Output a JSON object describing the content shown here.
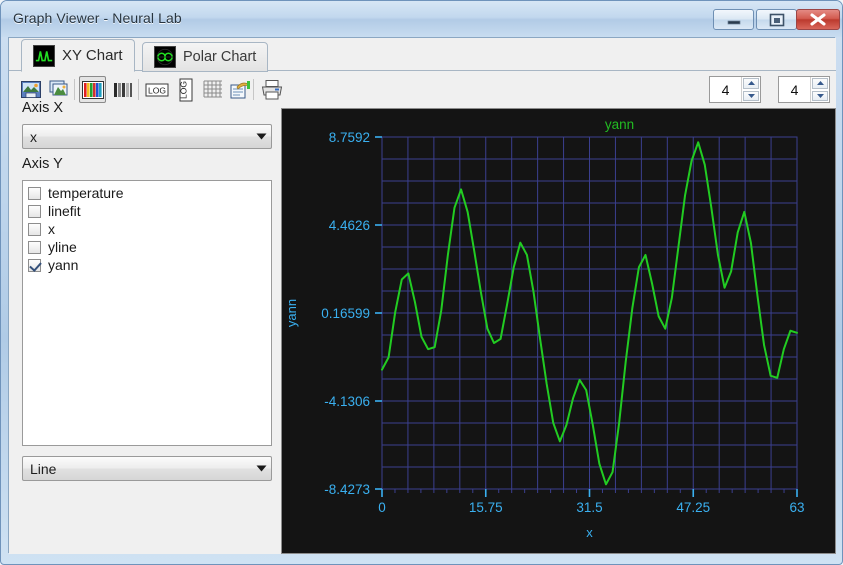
{
  "window": {
    "title": "Graph Viewer - Neural Lab",
    "buttons": [
      {
        "name": "minimize",
        "glyph": "minimize-icon"
      },
      {
        "name": "maximize",
        "glyph": "restore-icon"
      },
      {
        "name": "close",
        "glyph": "close-icon"
      }
    ]
  },
  "tabs": [
    {
      "label": "XY Chart",
      "icon": "waveform-icon",
      "active": true
    },
    {
      "label": "Polar Chart",
      "icon": "polar-grid-icon",
      "active": false
    }
  ],
  "toolbar": {
    "buttons": [
      {
        "name": "save-image-button",
        "icon": "save-image-icon",
        "pressed": false
      },
      {
        "name": "copy-image-button",
        "icon": "copy-image-icon",
        "pressed": false
      },
      {
        "name": "color-series-button",
        "icon": "color-bars-icon",
        "pressed": true
      },
      {
        "name": "grayscale-series-button",
        "icon": "gray-bars-icon",
        "pressed": false
      },
      {
        "name": "log-x-button",
        "icon": "log-x-icon",
        "pressed": false
      },
      {
        "name": "log-y-button",
        "icon": "log-y-icon",
        "pressed": false
      },
      {
        "name": "grid-button",
        "icon": "grid-icon",
        "pressed": false
      },
      {
        "name": "legend-button",
        "icon": "legend-icon",
        "pressed": false
      },
      {
        "name": "print-button",
        "icon": "printer-icon",
        "pressed": false
      }
    ],
    "spinner_columns": {
      "value": "4"
    },
    "spinner_rows": {
      "value": "4"
    }
  },
  "left_panel": {
    "axis_x_label": "Axis X",
    "axis_x_value": "x",
    "axis_y_label": "Axis Y",
    "series": [
      {
        "label": "temperature",
        "checked": false
      },
      {
        "label": "linefit",
        "checked": false
      },
      {
        "label": "x",
        "checked": false
      },
      {
        "label": "yline",
        "checked": false
      },
      {
        "label": "yann",
        "checked": true
      }
    ],
    "plot_type_value": "Line"
  },
  "colors": {
    "plot_background": "#141414",
    "grid": "#3b3f8f",
    "axis_text": "#3ab0f0",
    "series": "#22cc22",
    "title": "#22bb22"
  },
  "chart_data": {
    "type": "line",
    "title": "yann",
    "xlabel": "x",
    "ylabel": "yann",
    "grid": true,
    "legend": "none",
    "xlim": [
      0,
      63
    ],
    "ylim": [
      -8.4273,
      8.7592
    ],
    "xticks": [
      "0",
      "15.75",
      "31.5",
      "47.25",
      "63"
    ],
    "xtick_values": [
      0,
      15.75,
      31.5,
      47.25,
      63
    ],
    "yticks": [
      "8.7592",
      "4.4626",
      "0.16599",
      "-4.1306",
      "-8.4273"
    ],
    "ytick_values": [
      8.7592,
      4.4626,
      0.16599,
      -4.1306,
      -8.4273
    ],
    "series": [
      {
        "name": "yann",
        "color": "#22cc22",
        "x": [
          0,
          1,
          2,
          3,
          4,
          5,
          6,
          7,
          8,
          9,
          10,
          11,
          12,
          13,
          14,
          15,
          16,
          17,
          18,
          19,
          20,
          21,
          22,
          23,
          24,
          25,
          26,
          27,
          28,
          29,
          30,
          31,
          32,
          33,
          34,
          35,
          36,
          37,
          38,
          39,
          40,
          41,
          42,
          43,
          44,
          45,
          46,
          47,
          48,
          49,
          50,
          51,
          52,
          53,
          54,
          55,
          56,
          57,
          58,
          59,
          60,
          61,
          62,
          63
        ],
        "values": [
          -2.6,
          -2.0,
          0.2,
          1.8,
          2.1,
          0.7,
          -1.0,
          -1.6,
          -1.5,
          0.3,
          3.0,
          5.3,
          6.2,
          5.1,
          3.2,
          1.2,
          -0.6,
          -1.3,
          -1.1,
          0.6,
          2.4,
          3.6,
          3.0,
          1.2,
          -1.1,
          -3.3,
          -5.2,
          -6.1,
          -5.3,
          -4.0,
          -3.1,
          -3.6,
          -5.3,
          -7.2,
          -8.2,
          -7.6,
          -5.2,
          -2.2,
          0.4,
          2.4,
          3.0,
          1.6,
          0.0,
          -0.6,
          0.9,
          3.4,
          5.9,
          7.6,
          8.5,
          7.4,
          5.3,
          3.0,
          1.4,
          2.2,
          4.1,
          5.1,
          3.6,
          1.0,
          -1.4,
          -2.9,
          -3.0,
          -1.6,
          -0.7,
          -0.8
        ]
      }
    ]
  }
}
